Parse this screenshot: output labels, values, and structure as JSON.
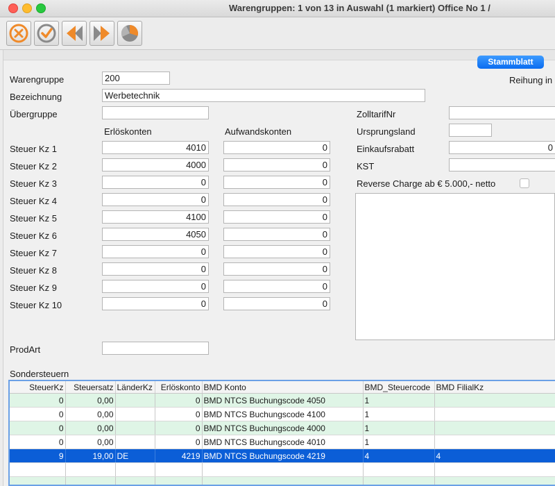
{
  "window": {
    "title": "Warengruppen: 1 von 13 in Auswahl  (1 markiert) Office No 1 /"
  },
  "toolbar": {
    "icons": [
      "cancel-icon",
      "confirm-icon",
      "previous-icon",
      "next-icon",
      "chart-icon"
    ]
  },
  "stammblatt_label": "Stammblatt",
  "reihung_label": "Reihung in",
  "form": {
    "warengruppe_label": "Warengruppe",
    "warengruppe_value": "200",
    "bezeichnung_label": "Bezeichnung",
    "bezeichnung_value": "Werbetechnik",
    "uebergruppe_label": "Übergruppe",
    "uebergruppe_value": "",
    "erloeskonten_header": "Erlöskonten",
    "aufwandskonten_header": "Aufwandskonten",
    "steuer_rows": [
      {
        "label": "Steuer Kz 1",
        "erloes": "4010",
        "aufwand": "0"
      },
      {
        "label": "Steuer Kz 2",
        "erloes": "4000",
        "aufwand": "0"
      },
      {
        "label": "Steuer Kz 3",
        "erloes": "0",
        "aufwand": "0"
      },
      {
        "label": "Steuer Kz 4",
        "erloes": "0",
        "aufwand": "0"
      },
      {
        "label": "Steuer Kz 5",
        "erloes": "4100",
        "aufwand": "0"
      },
      {
        "label": "Steuer Kz 6",
        "erloes": "4050",
        "aufwand": "0"
      },
      {
        "label": "Steuer Kz 7",
        "erloes": "0",
        "aufwand": "0"
      },
      {
        "label": "Steuer Kz 8",
        "erloes": "0",
        "aufwand": "0"
      },
      {
        "label": "Steuer Kz 9",
        "erloes": "0",
        "aufwand": "0"
      },
      {
        "label": "Steuer Kz 10",
        "erloes": "0",
        "aufwand": "0"
      }
    ],
    "prodart_label": "ProdArt",
    "prodart_value": "",
    "zolltarif_label": "ZolltarifNr",
    "zolltarif_value": "",
    "ursprungsland_label": "Ursprungsland",
    "ursprungsland_value": "",
    "einkaufsrabatt_label": "Einkaufsrabatt",
    "einkaufsrabatt_value": "0",
    "kst_label": "KST",
    "kst_value": "",
    "reverse_charge_label": "Reverse Charge ab € 5.000,- netto",
    "reverse_charge_checked": false
  },
  "sondersteuern": {
    "title": "Sondersteuern",
    "columns": [
      "SteuerKz",
      "Steuersatz",
      "LänderKz",
      "Erlöskonto",
      "BMD Konto",
      "BMD_Steuercode",
      "BMD FilialKz"
    ],
    "rows": [
      [
        "0",
        "0,00",
        "",
        "0",
        "BMD NTCS Buchungscode 4050",
        "1",
        ""
      ],
      [
        "0",
        "0,00",
        "",
        "0",
        "BMD NTCS Buchungscode 4100",
        "1",
        ""
      ],
      [
        "0",
        "0,00",
        "",
        "0",
        "BMD NTCS Buchungscode 4000",
        "1",
        ""
      ],
      [
        "0",
        "0,00",
        "",
        "0",
        "BMD NTCS Buchungscode 4010",
        "1",
        ""
      ],
      [
        "9",
        "19,00",
        "DE",
        "4219",
        "BMD NTCS Buchungscode 4219",
        "4",
        "4"
      ]
    ],
    "selected_row": 4
  },
  "colors": {
    "accent": "#0a6cf0",
    "row_alt": "#dff5e6",
    "selected": "#0b5ed7"
  }
}
